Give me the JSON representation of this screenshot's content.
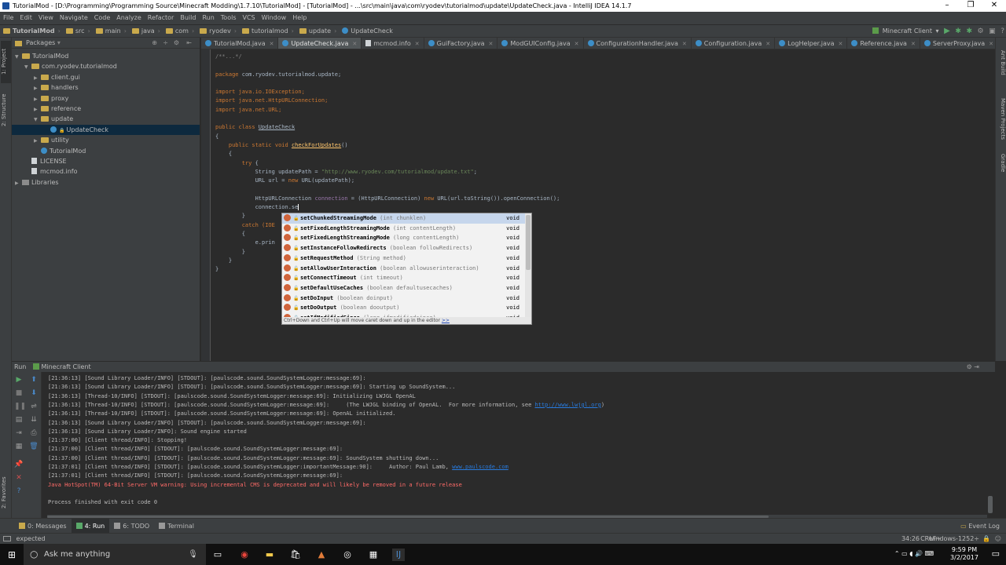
{
  "window": {
    "title": "TutorialMod - [D:\\Programming\\Programming Source\\Minecraft Modding\\1.7.10\\TutorialMod] - [TutorialMod] - ...\\src\\main\\java\\com\\ryodev\\tutorialmod\\update\\UpdateCheck.java - IntelliJ IDEA 14.1.7",
    "minimize": "–",
    "maximize": "❐",
    "close": "✕"
  },
  "menu": [
    "File",
    "Edit",
    "View",
    "Navigate",
    "Code",
    "Analyze",
    "Refactor",
    "Build",
    "Run",
    "Tools",
    "VCS",
    "Window",
    "Help"
  ],
  "breadcrumbs": [
    "TutorialMod",
    "src",
    "main",
    "java",
    "com",
    "ryodev",
    "tutorialmod",
    "update",
    "UpdateCheck"
  ],
  "run_config": "Minecraft Client",
  "project_panel": {
    "title": "Packages",
    "tree": [
      {
        "label": "TutorialMod",
        "depth": 0,
        "arrow": "▼",
        "kind": "fold"
      },
      {
        "label": "com.ryodev.tutorialmod",
        "depth": 1,
        "arrow": "▼",
        "kind": "fold"
      },
      {
        "label": "client.gui",
        "depth": 2,
        "arrow": "▶",
        "kind": "fold"
      },
      {
        "label": "handlers",
        "depth": 2,
        "arrow": "▶",
        "kind": "fold"
      },
      {
        "label": "proxy",
        "depth": 2,
        "arrow": "▶",
        "kind": "fold"
      },
      {
        "label": "reference",
        "depth": 2,
        "arrow": "▶",
        "kind": "fold"
      },
      {
        "label": "update",
        "depth": 2,
        "arrow": "▼",
        "kind": "fold"
      },
      {
        "label": "UpdateCheck",
        "depth": 3,
        "arrow": "",
        "kind": "cls",
        "selected": true
      },
      {
        "label": "utility",
        "depth": 2,
        "arrow": "▶",
        "kind": "fold"
      },
      {
        "label": "TutorialMod",
        "depth": 2,
        "arrow": "",
        "kind": "cls"
      },
      {
        "label": "LICENSE",
        "depth": 1,
        "arrow": "",
        "kind": "fil"
      },
      {
        "label": "mcmod.info",
        "depth": 1,
        "arrow": "",
        "kind": "fil"
      },
      {
        "label": "Libraries",
        "depth": 0,
        "arrow": "▶",
        "kind": "lib"
      }
    ]
  },
  "side_tabs": {
    "left_top": [
      "1: Project",
      "2: Structure"
    ],
    "left_bottom": [
      "2: Favorites"
    ],
    "right": [
      "Ant Build",
      "Maven Projects",
      "Gradle"
    ]
  },
  "tabs": [
    {
      "label": "TutorialMod.java",
      "kind": "cls"
    },
    {
      "label": "UpdateCheck.java",
      "kind": "cls",
      "active": true
    },
    {
      "label": "mcmod.info",
      "kind": "fil"
    },
    {
      "label": "GuiFactory.java",
      "kind": "cls"
    },
    {
      "label": "ModGUIConfig.java",
      "kind": "cls"
    },
    {
      "label": "ConfigurationHandler.java",
      "kind": "cls"
    },
    {
      "label": "Configuration.java",
      "kind": "cls"
    },
    {
      "label": "LogHelper.java",
      "kind": "cls"
    },
    {
      "label": "Reference.java",
      "kind": "cls"
    },
    {
      "label": "ServerProxy.java",
      "kind": "cls"
    }
  ],
  "code": {
    "fold_comment": "/**...*/",
    "package_kw": "package",
    "package_name": " com.ryodev.tutorialmod.update;",
    "imports": [
      "import java.io.IOException;",
      "import java.net.HttpURLConnection;",
      "import java.net.URL;"
    ],
    "class_decl_kw": "public class",
    "class_name": "UpdateCheck",
    "open_brace": "{",
    "method_kw": "public static void",
    "method_name": "checkForUpdates",
    "method_parens": "()",
    "try_kw": "try",
    "line_updatepath_a": "String updatePath = ",
    "line_updatepath_str": "\"http://www.ryodev.com/tutorialmod/update.txt\"",
    "line_url_a": "URL url = ",
    "line_url_new": "new",
    "line_url_b": " URL(updatePath);",
    "line_conn_a": "HttpURLConnection ",
    "line_conn_var": "connection",
    "line_conn_b": " = (HttpURLConnection) ",
    "line_conn_new": "new",
    "line_conn_c": " URL(url.toString()).openConnection();",
    "line_typing": "connection.se",
    "close_brace": "}",
    "catch_text": "catch (IOE",
    "print_text": "e.prin"
  },
  "completion": {
    "items": [
      {
        "name": "setChunkedStreamingMode",
        "params": "(int chunklen)",
        "ret": "void",
        "selected": true
      },
      {
        "name": "setFixedLengthStreamingMode",
        "params": "(int contentLength)",
        "ret": "void"
      },
      {
        "name": "setFixedLengthStreamingMode",
        "params": "(long contentLength)",
        "ret": "void"
      },
      {
        "name": "setInstanceFollowRedirects",
        "params": "(boolean followRedirects)",
        "ret": "void"
      },
      {
        "name": "setRequestMethod",
        "params": "(String method)",
        "ret": "void"
      },
      {
        "name": "setAllowUserInteraction",
        "params": "(boolean allowuserinteraction)",
        "ret": "void"
      },
      {
        "name": "setConnectTimeout",
        "params": "(int timeout)",
        "ret": "void"
      },
      {
        "name": "setDefaultUseCaches",
        "params": "(boolean defaultusecaches)",
        "ret": "void"
      },
      {
        "name": "setDoInput",
        "params": "(boolean doinput)",
        "ret": "void"
      },
      {
        "name": "setDoOutput",
        "params": "(boolean dooutput)",
        "ret": "void"
      },
      {
        "name": "setIfModifiedSince",
        "params": "(long ifmodifiedsince)",
        "ret": "void"
      }
    ],
    "footer": "Ctrl+Down and Ctrl+Up will move caret down and up in the editor",
    "footer_link": ">>"
  },
  "run_panel": {
    "label": "Run",
    "config": "Minecraft Client",
    "lines": [
      {
        "text": "[21:36:13] [Sound Library Loader/INFO] [STDOUT]: [paulscode.sound.SoundSystemLogger:message:69]:"
      },
      {
        "text": "[21:36:13] [Sound Library Loader/INFO] [STDOUT]: [paulscode.sound.SoundSystemLogger:message:69]: Starting up SoundSystem..."
      },
      {
        "text": "[21:36:13] [Thread-10/INFO] [STDOUT]: [paulscode.sound.SoundSystemLogger:message:69]: Initializing LWJGL OpenAL"
      },
      {
        "text": "[21:36:13] [Thread-10/INFO] [STDOUT]: [paulscode.sound.SoundSystemLogger:message:69]:     (The LWJGL binding of OpenAL.  For more information, see ",
        "link": "http://www.lwjgl.org",
        "after": ")"
      },
      {
        "text": "[21:36:13] [Thread-10/INFO] [STDOUT]: [paulscode.sound.SoundSystemLogger:message:69]: OpenAL initialized."
      },
      {
        "text": "[21:36:13] [Sound Library Loader/INFO] [STDOUT]: [paulscode.sound.SoundSystemLogger:message:69]:"
      },
      {
        "text": "[21:36:13] [Sound Library Loader/INFO]: Sound engine started"
      },
      {
        "text": "[21:37:00] [Client thread/INFO]: Stopping!"
      },
      {
        "text": "[21:37:00] [Client thread/INFO] [STDOUT]: [paulscode.sound.SoundSystemLogger:message:69]:"
      },
      {
        "text": "[21:37:00] [Client thread/INFO] [STDOUT]: [paulscode.sound.SoundSystemLogger:message:69]: SoundSystem shutting down..."
      },
      {
        "text": "[21:37:01] [Client thread/INFO] [STDOUT]: [paulscode.sound.SoundSystemLogger:importantMessage:90]:     Author: Paul Lamb, ",
        "link": "www.paulscode.com",
        "after": ""
      },
      {
        "text": "[21:37:01] [Client thread/INFO] [STDOUT]: [paulscode.sound.SoundSystemLogger:message:69]:"
      },
      {
        "text": "Java HotSpot(TM) 64-Bit Server VM warning: Using incremental CMS is deprecated and will likely be removed in a future release",
        "error": true
      },
      {
        "text": ""
      },
      {
        "text": "Process finished with exit code 0"
      }
    ]
  },
  "bottom_tabs": [
    {
      "label": "0: Messages"
    },
    {
      "label": "4: Run",
      "active": true
    },
    {
      "label": "6: TODO"
    },
    {
      "label": "Terminal"
    }
  ],
  "event_log": "Event Log",
  "status": {
    "message": "expected",
    "position": "34:26",
    "line_sep": "CRLF÷",
    "encoding": "windows-1252÷"
  },
  "taskbar": {
    "search_placeholder": "Ask me anything",
    "time": "9:59 PM",
    "date": "3/2/2017"
  },
  "colors": {
    "accent": "#0d293e",
    "keyword": "#cc7832",
    "string": "#6a8759",
    "method": "#ffc66d",
    "field": "#9876aa",
    "error": "#ff6b68",
    "link": "#287bde"
  }
}
